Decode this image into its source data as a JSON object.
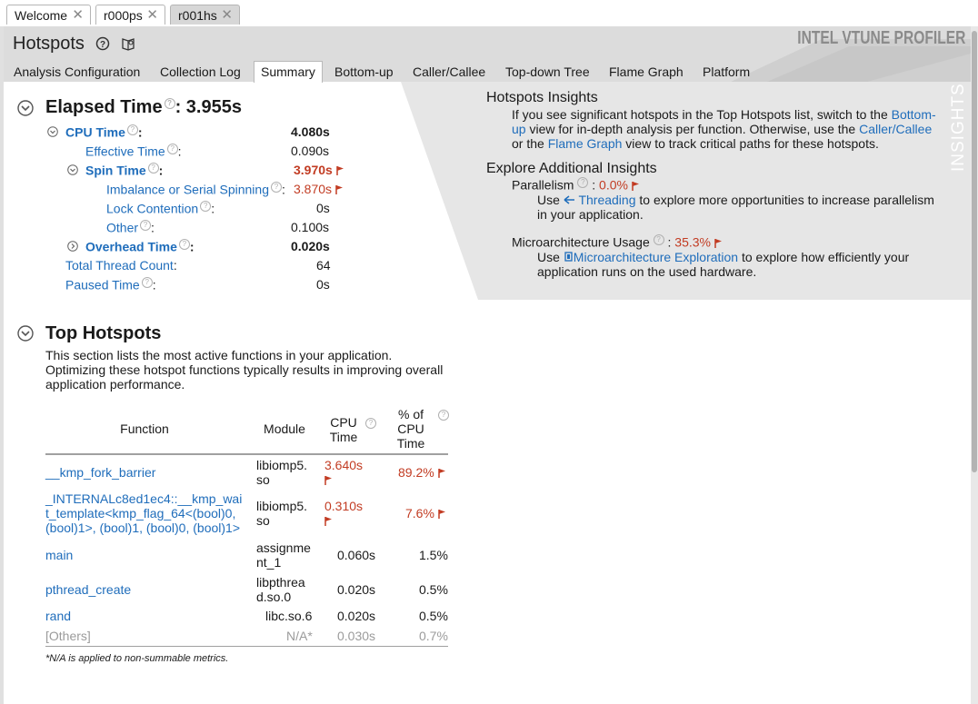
{
  "doc_tabs": [
    {
      "label": "Welcome"
    },
    {
      "label": "r000ps"
    },
    {
      "label": "r001hs"
    }
  ],
  "header": {
    "title": "Hotspots",
    "logo": "INTEL VTUNE PROFILER",
    "views": [
      "Analysis Configuration",
      "Collection Log",
      "Summary",
      "Bottom-up",
      "Caller/Callee",
      "Top-down Tree",
      "Flame Graph",
      "Platform"
    ],
    "active_view": "Summary"
  },
  "elapsed": {
    "label": "Elapsed Time",
    "value": ": 3.955s",
    "metrics": [
      {
        "label": "CPU Time",
        "colon": ":",
        "value": "4.080s"
      },
      {
        "label": "Effective Time",
        "colon": ":",
        "value": "0.090s"
      },
      {
        "label": "Spin Time",
        "colon": ":",
        "value": "3.970s"
      },
      {
        "label": "Imbalance or Serial Spinning",
        "colon": ":",
        "value": "3.870s"
      },
      {
        "label": "Lock Contention",
        "colon": ":",
        "value": "0s"
      },
      {
        "label": "Other",
        "colon": ":",
        "value": "0.100s"
      },
      {
        "label": "Overhead Time",
        "colon": ":",
        "value": "0.020s"
      },
      {
        "label": "Total Thread Count",
        "colon": ":",
        "value": "64"
      },
      {
        "label": "Paused Time",
        "colon": ":",
        "value": "0s"
      }
    ]
  },
  "insights": {
    "side_label": "INSIGHTS",
    "hotspots_title": "Hotspots Insights",
    "hotspots_text": [
      {
        "t": "If you see significant hotspots in the Top Hotspots list, switch to the "
      },
      {
        "t": "Bottom-"
      },
      {
        "t": "up"
      },
      {
        "t": " view for in-depth analysis per function. Otherwise, use the "
      },
      {
        "t": "Caller/Callee"
      },
      {
        "t": "or the "
      },
      {
        "t": "Flame Graph"
      },
      {
        "t": " view to track critical paths for these hotspots."
      }
    ],
    "explore_title": "Explore Additional Insights",
    "parallelism_label": "Parallelism",
    "parallelism_value": "0.0%",
    "parallelism_use": "Use",
    "parallelism_link": "Threading",
    "parallelism_rest": " to explore more opportunities to increase parallelism",
    "parallelism_rest2": "in your application.",
    "micro_label": "Microarchitecture Usage",
    "micro_value": "35.3%",
    "micro_use": "Use",
    "micro_link": "Microarchitecture Exploration",
    "micro_rest": " to explore how efficiently your",
    "micro_rest2": "application runs on the used hardware."
  },
  "top_hotspots": {
    "title": "Top Hotspots",
    "desc": [
      "This section lists the most active functions in your application.",
      "Optimizing these hotspot functions typically results in improving overall",
      "application performance."
    ],
    "columns": {
      "function": "Function",
      "module": "Module",
      "cpu": [
        "CPU",
        "Time"
      ],
      "pct": [
        "% of",
        "CPU",
        "Time"
      ]
    },
    "rows": [
      {
        "function": [
          "__kmp_fork_barrier"
        ],
        "module": [
          "libiomp5.",
          "so"
        ],
        "cpu": "3.640s",
        "pct": "89.2%"
      },
      {
        "function": [
          "_INTERNALc8ed1ec4::__kmp_wai",
          "t_template<kmp_flag_64<(bool)0,",
          "(bool)1>, (bool)1, (bool)0, (bool)1>"
        ],
        "module": [
          "libiomp5.",
          "so"
        ],
        "cpu": "0.310s",
        "pct": "7.6%"
      },
      {
        "function": [
          "main"
        ],
        "module": [
          "assignme",
          "nt_1"
        ],
        "cpu": "0.060s",
        "pct": "1.5%"
      },
      {
        "function": [
          "pthread_create"
        ],
        "module": [
          "libpthrea",
          "d.so.0"
        ],
        "cpu": "0.020s",
        "pct": "0.5%"
      },
      {
        "function": [
          "rand"
        ],
        "module": [
          "libc.so.6"
        ],
        "cpu": "0.020s",
        "pct": "0.5%"
      },
      {
        "function": [
          "[Others]"
        ],
        "module": [
          "N/A*"
        ],
        "cpu": "0.030s",
        "pct": "0.7%"
      }
    ],
    "footnote": "*N/A is applied to non-summable metrics."
  },
  "colors": {
    "accent": "#1f6dbb",
    "warn": "#c23c23",
    "header_bg": "#dcdcdc",
    "insight_bg": "#e6e6e6"
  }
}
